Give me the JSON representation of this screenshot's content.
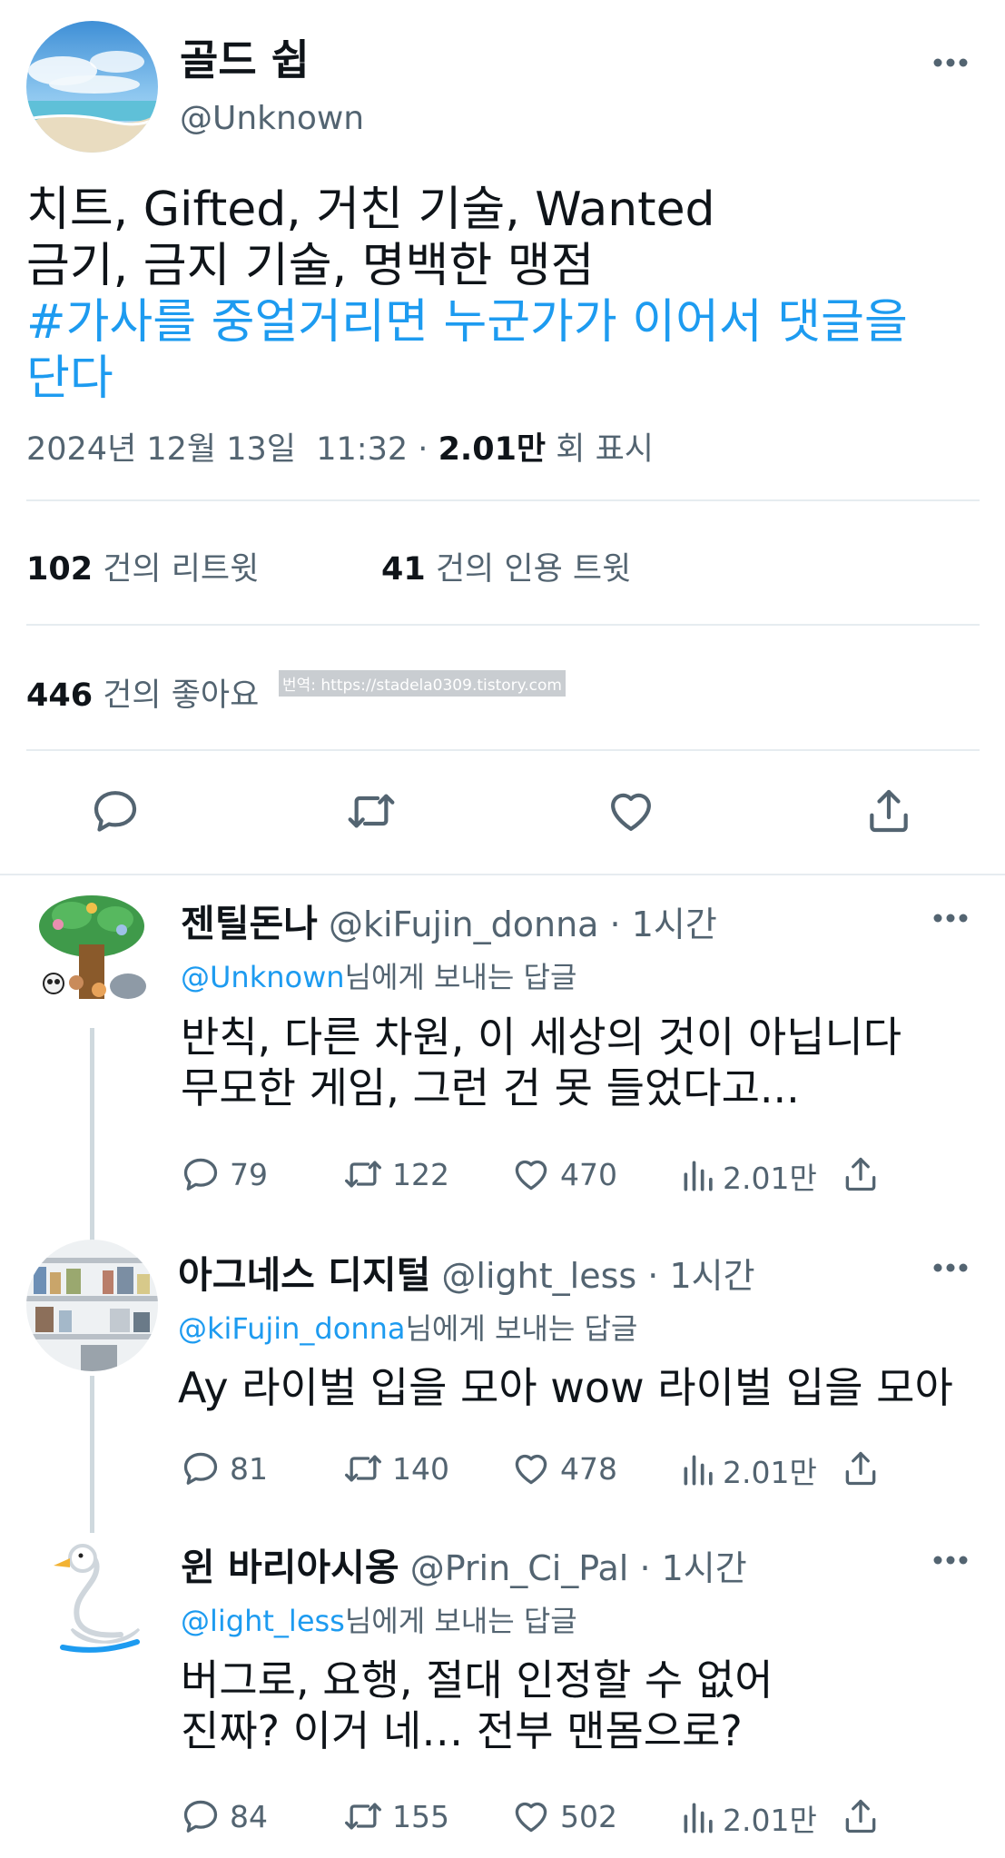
{
  "main_tweet": {
    "display_name": "골드 쉽",
    "handle": "@Unknown",
    "text_lines": [
      "치트, Gifted, 거친 기술, Wanted",
      "금기, 금지 기술, 명백한 맹점"
    ],
    "hashtag_lines": [
      "#가사를 중얼거리면 누군가가 이어서 댓글을",
      "단다"
    ],
    "date": "2024년 12월 13일",
    "time": "11:32",
    "separator": "·",
    "views_count": "2.01만",
    "views_label": "회 표시",
    "retweets_count": "102",
    "retweets_label": "건의 리트윗",
    "quotes_count": "41",
    "quotes_label": "건의 인용 트윗",
    "likes_count": "446",
    "likes_label": "건의 좋아요",
    "watermark": "번역: https://stadela0309.tistory.com"
  },
  "replies": [
    {
      "display_name": "젠틸돈나",
      "handle": "@kiFujin_donna",
      "time": "· 1시간",
      "reply_to_mention": "@Unknown",
      "reply_to_suffix": "님에게 보내는 답글",
      "text_lines": [
        "반칙, 다른 차원, 이 세상의 것이 아닙니다",
        "무모한 게임, 그런 건 못 들었다고..."
      ],
      "replies": "79",
      "retweets": "122",
      "likes": "470",
      "views": "2.01만"
    },
    {
      "display_name": "아그네스 디지털",
      "handle": "@light_less",
      "time": "· 1시간",
      "reply_to_mention": "@kiFujin_donna",
      "reply_to_suffix": "님에게 보내는 답글",
      "text_lines": [
        "Ay 라이벌 입을 모아 wow 라이벌 입을 모아"
      ],
      "replies": "81",
      "retweets": "140",
      "likes": "478",
      "views": "2.01만"
    },
    {
      "display_name": "윈 바리아시옹",
      "handle": "@Prin_Ci_Pal",
      "time": "· 1시간",
      "reply_to_mention": "@light_less",
      "reply_to_suffix": "님에게 보내는 답글",
      "text_lines": [
        "버그로, 요행, 절대 인정할 수 없어",
        "진짜? 이거 네… 전부 맨몸으로?"
      ],
      "replies": "84",
      "retweets": "155",
      "likes": "502",
      "views": "2.01만"
    }
  ],
  "icons": {
    "reply": "speech-bubble-icon",
    "retweet": "retweet-arrows-icon",
    "like": "heart-icon",
    "views": "bar-chart-icon",
    "share": "share-upload-icon",
    "more": "more-dots-icon"
  },
  "colors": {
    "accent": "#1d9bf0",
    "text": "#0f1419",
    "muted": "#536471",
    "divider": "#e6ecf0"
  }
}
